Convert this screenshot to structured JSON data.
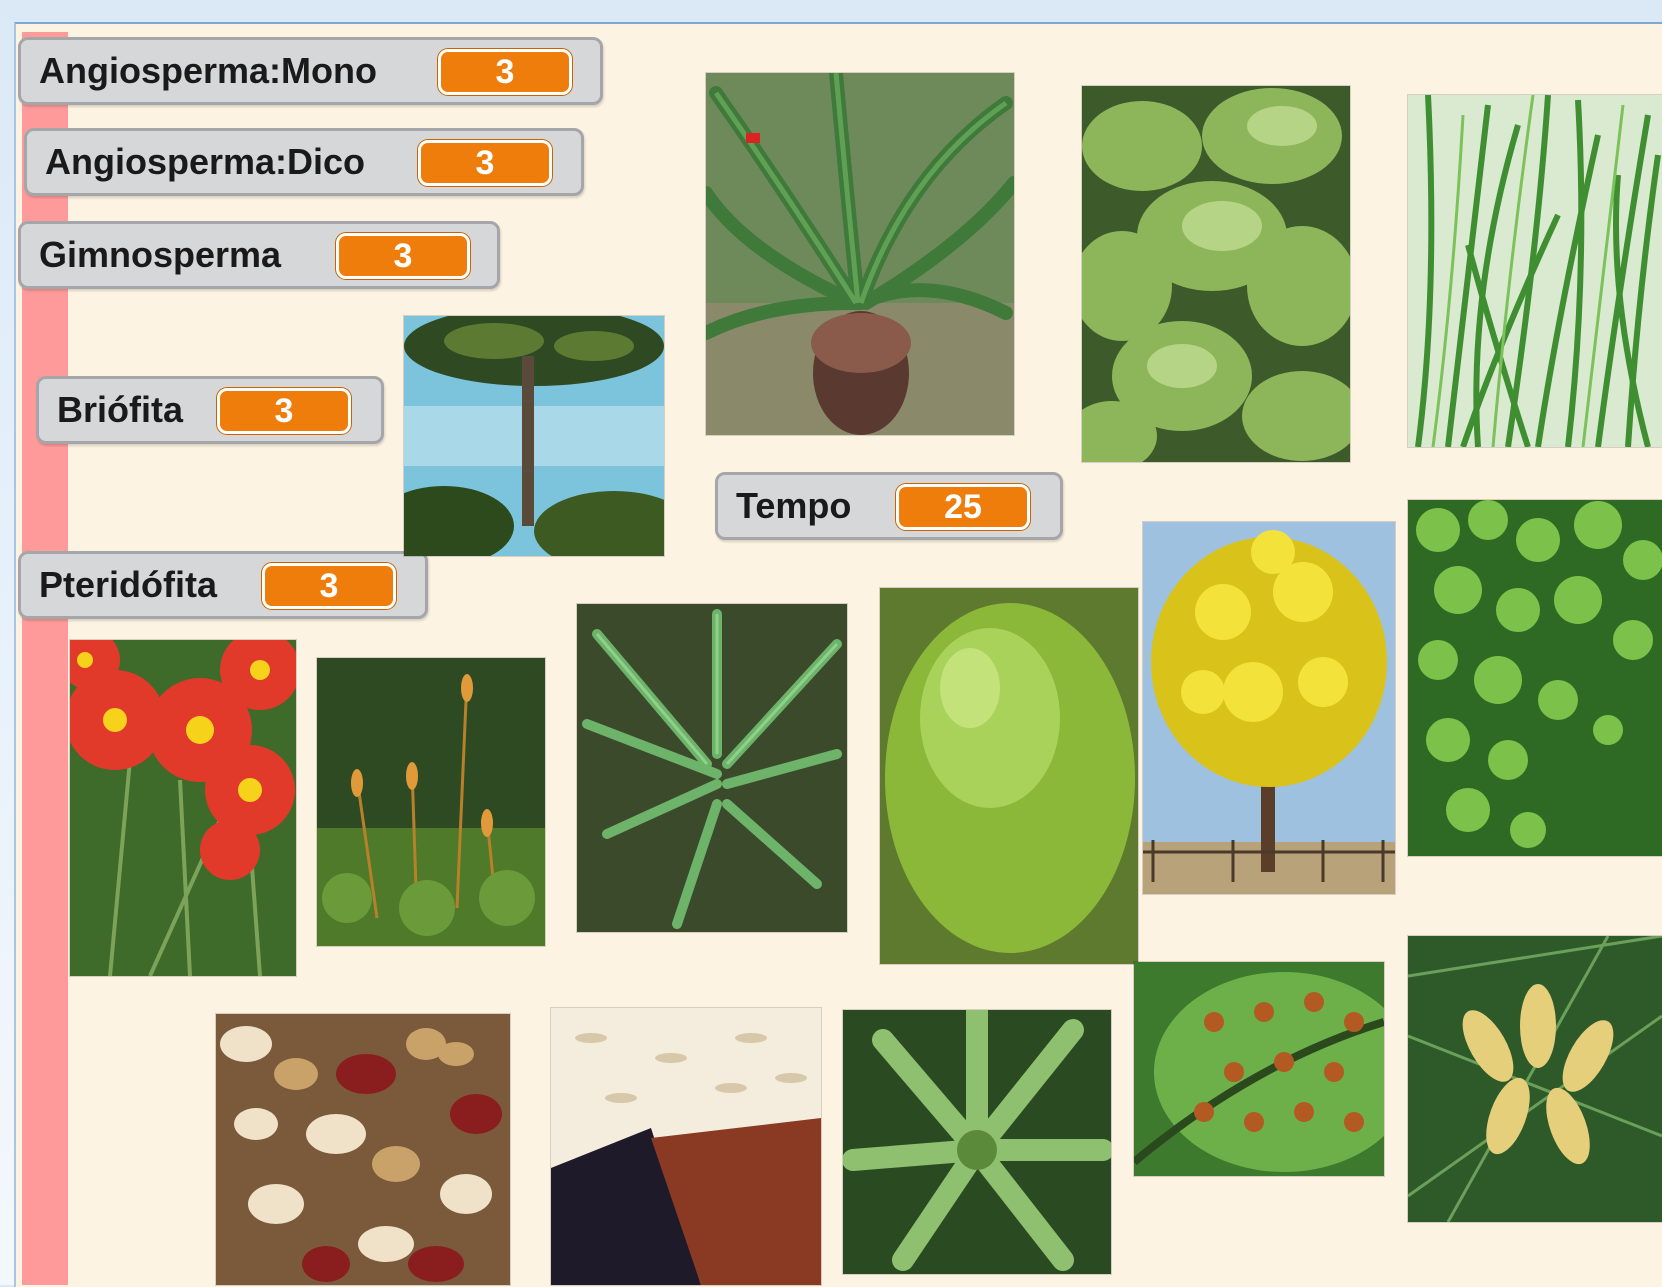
{
  "monitors": {
    "angiosperma_mono": {
      "label": "Angiosperma:Mono",
      "value": "3"
    },
    "angiosperma_dico": {
      "label": "Angiosperma:Dico",
      "value": "3"
    },
    "gimnosperma": {
      "label": "Gimnosperma",
      "value": "3"
    },
    "briofita": {
      "label": "Briófita",
      "value": "3"
    },
    "tempo": {
      "label": "Tempo",
      "value": "25"
    },
    "pteridofita": {
      "label": "Pteridófita",
      "value": "3"
    }
  },
  "sprites": [
    "cycad-palm",
    "liverwort",
    "grass",
    "araucaria-tree",
    "yellow-ipe-tree",
    "maidenhair-fern",
    "red-daisies",
    "moss-sporophytes",
    "fern-fronds",
    "moss-cushion",
    "beans",
    "rice",
    "bromeliad",
    "fern-sori",
    "pine-cones"
  ]
}
